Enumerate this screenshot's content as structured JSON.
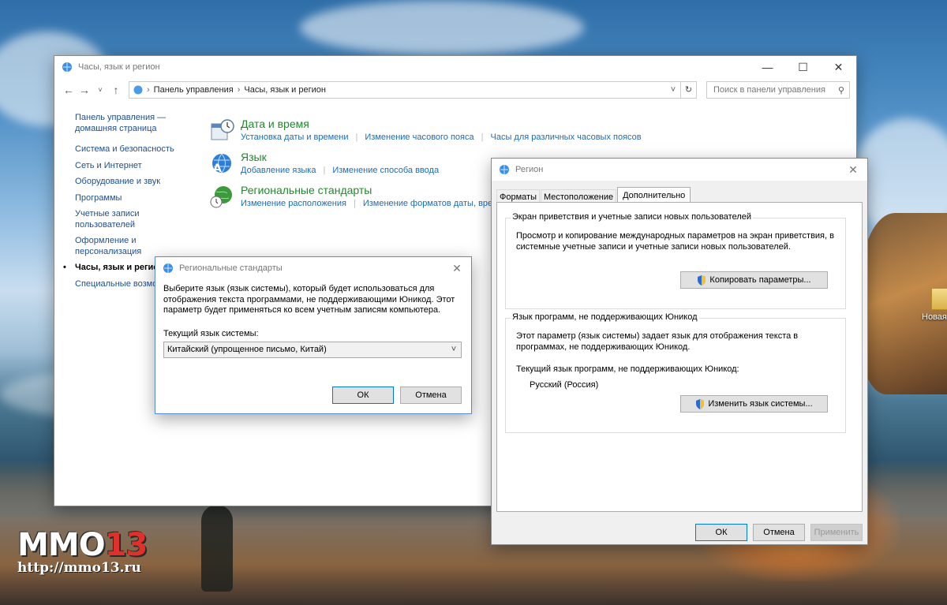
{
  "desktop": {
    "icon_label": "Новая па",
    "watermark_logo_main": "MMO",
    "watermark_logo_num": "13",
    "watermark_url": "http://mmo13.ru"
  },
  "control_panel": {
    "title": "Часы, язык и регион",
    "breadcrumb": [
      "Панель управления",
      "Часы, язык и регион"
    ],
    "search_placeholder": "Поиск в панели управления",
    "sidebar": {
      "home": "Панель управления — домашняя страница",
      "items": [
        "Система и безопасность",
        "Сеть и Интернет",
        "Оборудование и звук",
        "Программы",
        "Учетные записи пользователей",
        "Оформление и персонализация",
        "Часы, язык и регион",
        "Специальные возмо"
      ]
    },
    "categories": [
      {
        "title": "Дата и время",
        "links": [
          "Установка даты и времени",
          "Изменение часового пояса",
          "Часы для различных часовых поясов"
        ]
      },
      {
        "title": "Язык",
        "links": [
          "Добавление языка",
          "Изменение способа ввода"
        ]
      },
      {
        "title": "Региональные стандарты",
        "links": [
          "Изменение расположения",
          "Изменение форматов даты, врем"
        ]
      }
    ]
  },
  "regional_dialog": {
    "title": "Региональные стандарты",
    "description": "Выберите язык (язык системы), который будет использоваться для отображения текста программами, не поддерживающими Юникод. Этот параметр будет применяться ко всем учетным записям компьютера.",
    "current_label": "Текущий язык системы:",
    "selected_language": "Китайский (упрощенное письмо, Китай)",
    "ok": "ОК",
    "cancel": "Отмена"
  },
  "region_dialog": {
    "title": "Регион",
    "tabs": [
      "Форматы",
      "Местоположение",
      "Дополнительно"
    ],
    "group1": {
      "title": "Экран приветствия и учетные записи новых пользователей",
      "text": "Просмотр и копирование международных параметров на экран приветствия, в системные учетные записи и учетные записи новых пользователей.",
      "button": "Копировать параметры..."
    },
    "group2": {
      "title": "Язык программ, не поддерживающих Юникод",
      "text": "Этот параметр (язык системы) задает язык для отображения текста в программах, не поддерживающих Юникод.",
      "current_label": "Текущий язык программ, не поддерживающих Юникод:",
      "current_value": "Русский (Россия)",
      "button": "Изменить язык системы..."
    },
    "ok": "ОК",
    "cancel": "Отмена",
    "apply": "Применить"
  },
  "colors": {
    "link": "#1f6ab6",
    "category_title": "#1f8a2a",
    "accent": "#0078d7"
  }
}
